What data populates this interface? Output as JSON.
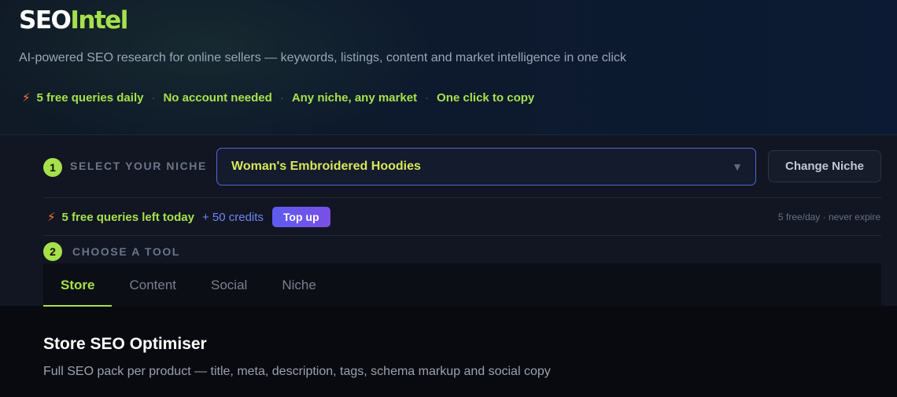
{
  "header": {
    "logo_part1": "SEO",
    "logo_part2": "Intel",
    "tagline": "AI-powered SEO research for online sellers — keywords, listings, content and market intelligence in one click",
    "features": [
      "5 free queries daily",
      "No account needed",
      "Any niche, any market",
      "One click to copy"
    ]
  },
  "step1": {
    "number": "1",
    "label": "SELECT YOUR NICHE",
    "selected_niche": "Woman's Embroidered Hoodies",
    "change_button": "Change Niche"
  },
  "credits": {
    "free_left": "5 free queries left today",
    "extra_credits": "+ 50 credits",
    "topup_button": "Top up",
    "note": "5 free/day · never expire"
  },
  "step2": {
    "number": "2",
    "label": "CHOOSE A TOOL",
    "tabs": [
      {
        "label": "Store",
        "active": true
      },
      {
        "label": "Content",
        "active": false
      },
      {
        "label": "Social",
        "active": false
      },
      {
        "label": "Niche",
        "active": false
      }
    ]
  },
  "tool": {
    "title": "Store SEO Optimiser",
    "description": "Full SEO pack per product — title, meta, description, tags, schema markup and social copy"
  },
  "colors": {
    "accent": "#a6e14b",
    "purple": "#6f86f0",
    "bolt": "#ff7a3d"
  }
}
